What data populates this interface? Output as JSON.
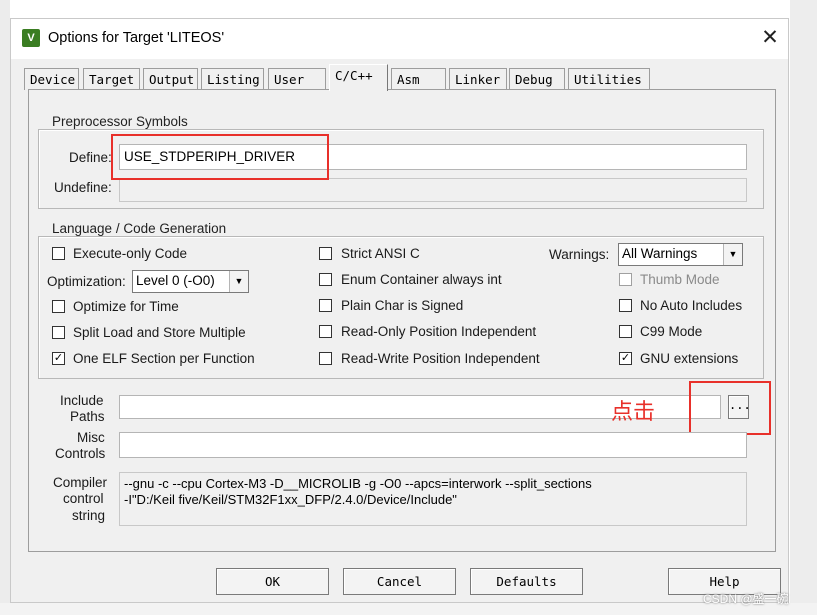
{
  "window": {
    "title": "Options for Target 'LITEOS'",
    "close_glyph": "✕",
    "app_icon_glyph": "V"
  },
  "tabs": [
    {
      "label": "Device"
    },
    {
      "label": "Target"
    },
    {
      "label": "Output"
    },
    {
      "label": "Listing"
    },
    {
      "label": "User"
    },
    {
      "label": "C/C++",
      "active": true
    },
    {
      "label": "Asm"
    },
    {
      "label": "Linker"
    },
    {
      "label": "Debug"
    },
    {
      "label": "Utilities"
    }
  ],
  "preprocessor": {
    "title": "Preprocessor Symbols",
    "define_label": "Define:",
    "define_value": "USE_STDPERIPH_DRIVER",
    "undefine_label": "Undefine:",
    "undefine_value": ""
  },
  "language": {
    "title": "Language / Code Generation",
    "execute_only": {
      "label": "Execute-only Code",
      "checked": false
    },
    "optimization_label": "Optimization:",
    "optimization_value": "Level 0 (-O0)",
    "optimize_time": {
      "label": "Optimize for Time",
      "checked": false
    },
    "split_load": {
      "label": "Split Load and Store Multiple",
      "checked": false
    },
    "one_elf": {
      "label": "One ELF Section per Function",
      "checked": true
    },
    "strict_ansi": {
      "label": "Strict ANSI C",
      "checked": false
    },
    "enum_container": {
      "label": "Enum Container always int",
      "checked": false
    },
    "plain_char": {
      "label": "Plain Char is Signed",
      "checked": false
    },
    "ro_pos": {
      "label": "Read-Only Position Independent",
      "checked": false
    },
    "rw_pos": {
      "label": "Read-Write Position Independent",
      "checked": false
    },
    "warnings_label": "Warnings:",
    "warnings_value": "All Warnings",
    "thumb_mode": {
      "label": "Thumb Mode",
      "checked": false,
      "disabled": true
    },
    "no_auto_includes": {
      "label": "No Auto Includes",
      "checked": false
    },
    "c99_mode": {
      "label": "C99 Mode",
      "checked": false
    },
    "gnu_ext": {
      "label": "GNU extensions",
      "checked": true
    }
  },
  "include_paths": {
    "label_line1": "Include",
    "label_line2": "Paths",
    "value": "",
    "browse_label": "..."
  },
  "misc_controls": {
    "label_line1": "Misc",
    "label_line2": "Controls",
    "value": ""
  },
  "compiler_string": {
    "label_line1": "Compiler",
    "label_line2": "control",
    "label_line3": "string",
    "line1": "--gnu -c --cpu Cortex-M3 -D__MICROLIB -g -O0 --apcs=interwork --split_sections",
    "line2": "-I\"D:/Keil five/Keil/STM32F1xx_DFP/2.4.0/Device/Include\""
  },
  "buttons": {
    "ok": "OK",
    "cancel": "Cancel",
    "defaults": "Defaults",
    "help": "Help"
  },
  "annotation": {
    "text": "点击",
    "color": "#e8302a"
  },
  "watermark": "CSDN @盛一碗",
  "check_glyph": "✓",
  "combo_arrow_glyph": "▼"
}
